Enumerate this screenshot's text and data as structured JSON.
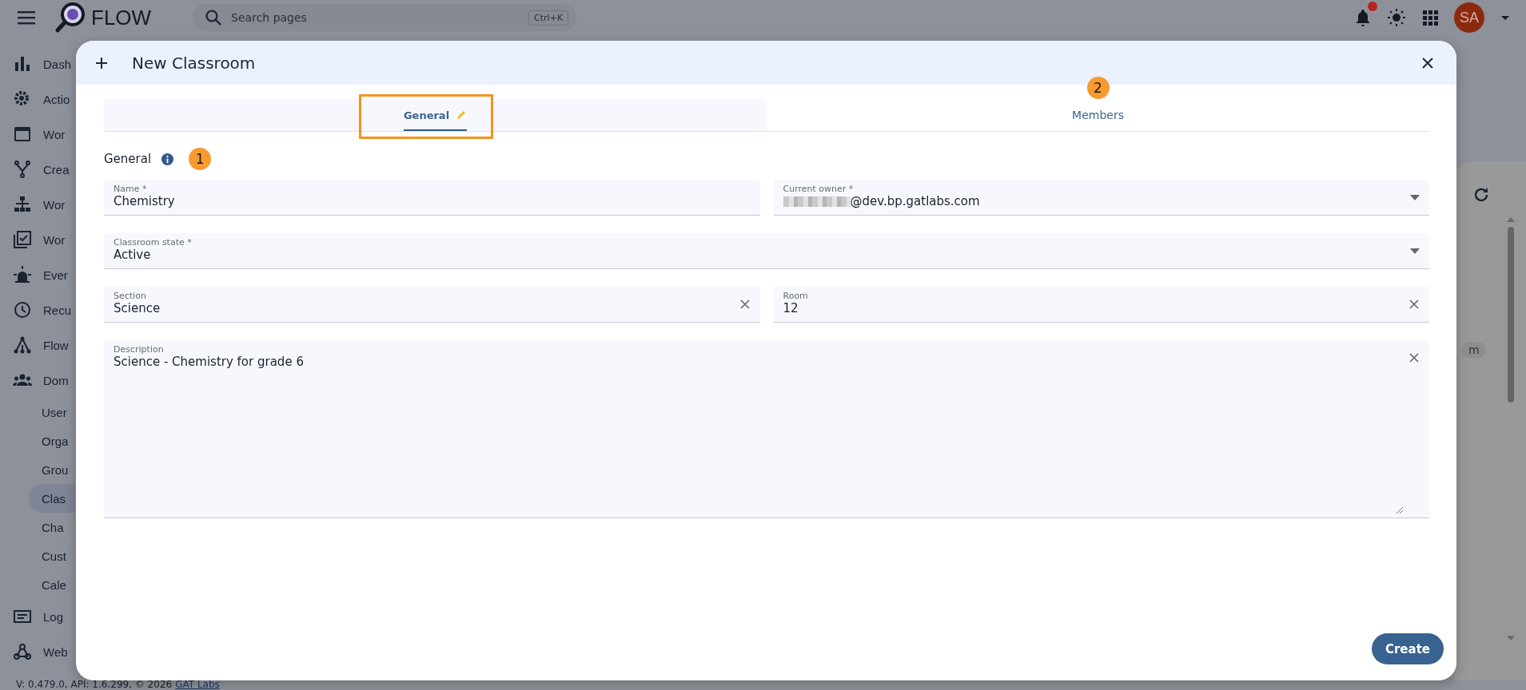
{
  "top_bar": {
    "app_name": "FLOW",
    "search": {
      "placeholder": "Search pages",
      "shortcut": "Ctrl+K"
    },
    "notifications": {
      "unread": true
    },
    "avatar": {
      "initials": "SA"
    }
  },
  "sidebar": {
    "items": [
      {
        "label": "Dash"
      },
      {
        "label": "Actio"
      },
      {
        "label": "Wor"
      },
      {
        "label": "Crea"
      },
      {
        "label": "Wor"
      },
      {
        "label": "Wor"
      },
      {
        "label": "Ever"
      },
      {
        "label": "Recu"
      },
      {
        "label": "Flow"
      },
      {
        "label": "Dom",
        "children": [
          {
            "label": "User",
            "selected": false
          },
          {
            "label": "Orga",
            "selected": false
          },
          {
            "label": "Grou",
            "selected": false
          },
          {
            "label": "Clas",
            "selected": true
          },
          {
            "label": "Cha",
            "selected": false
          },
          {
            "label": "Cust",
            "selected": false
          },
          {
            "label": "Cale",
            "selected": false
          }
        ]
      },
      {
        "label": "Log"
      },
      {
        "label": "Web"
      }
    ]
  },
  "footer": {
    "version": "V: 0.479.0, API: 1.6.299, © 2026",
    "link": "GAT Labs"
  },
  "background_card": {
    "chip": "m"
  },
  "dialog": {
    "title": "New Classroom",
    "tabs": [
      {
        "label": "General",
        "selected": true,
        "edited": true,
        "highlighted": true
      },
      {
        "label": "Members",
        "selected": false,
        "edited": false,
        "highlighted": false,
        "badge": "2"
      }
    ],
    "section": {
      "title": "General",
      "badge": "1"
    },
    "rows": [
      [
        {
          "kind": "text",
          "label": "Name *",
          "value": "Chemistry",
          "clearable": false
        },
        {
          "kind": "select",
          "label": "Current owner *",
          "value": "@dev.bp.gatlabs.com",
          "redacted": true
        }
      ],
      [
        {
          "kind": "select",
          "label": "Classroom state *",
          "value": "Active"
        }
      ],
      [
        {
          "kind": "text",
          "label": "Section",
          "value": "Science",
          "clearable": true
        },
        {
          "kind": "text",
          "label": "Room",
          "value": "12",
          "clearable": true
        }
      ],
      [
        {
          "kind": "textarea",
          "label": "Description",
          "value": "Science - Chemistry for grade 6",
          "clearable": true
        }
      ]
    ],
    "button": "Create"
  }
}
